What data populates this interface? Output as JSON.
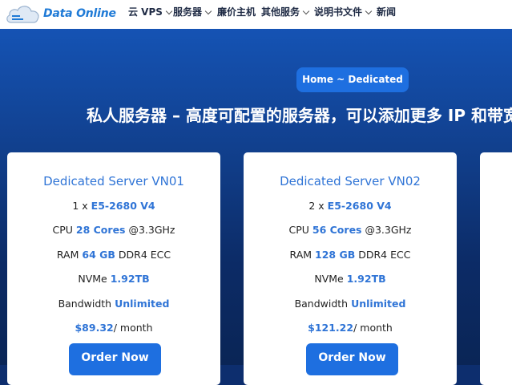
{
  "header": {
    "logo_text": "Data Online",
    "nav": [
      {
        "label": "云 VPS"
      },
      {
        "label": "服务器"
      },
      {
        "label": "廉价主机"
      },
      {
        "label": "其他服务"
      },
      {
        "label": "说明书文件"
      },
      {
        "label": "新闻"
      }
    ]
  },
  "hero": {
    "breadcrumb": "Home ~ Dedicated",
    "headline": "私人服务器 – 高度可配置的服务器，可以添加更多 IP 和带宽"
  },
  "cards": [
    {
      "title": "Dedicated Server VN01",
      "cpu_qty": "1 x",
      "cpu_model": "E5-2680 V4",
      "cpu_label": "CPU",
      "cores": "28 Cores",
      "clock": "@3.3GHz",
      "ram_label": "RAM",
      "ram_size": "64 GB",
      "ram_type": "DDR4 ECC",
      "nvme_label": "NVMe",
      "nvme_size": "1.92TB",
      "bw_label": "Bandwidth",
      "bw_value": "Unlimited",
      "price": "$89.32",
      "period": "/ month",
      "order": "Order Now"
    },
    {
      "title": "Dedicated Server VN02",
      "cpu_qty": "2 x",
      "cpu_model": "E5-2680 V4",
      "cpu_label": "CPU",
      "cores": "56 Cores",
      "clock": "@3.3GHz",
      "ram_label": "RAM",
      "ram_size": "128 GB",
      "ram_type": "DDR4 ECC",
      "nvme_label": "NVMe",
      "nvme_size": "1.92TB",
      "bw_label": "Bandwidth",
      "bw_value": "Unlimited",
      "price": "$121.22",
      "period": "/ month",
      "order": "Order Now"
    }
  ],
  "colors": {
    "brand_blue": "#1e6fe0",
    "accent_text": "#2f74d6",
    "hero_dark": "#0c2b66"
  }
}
